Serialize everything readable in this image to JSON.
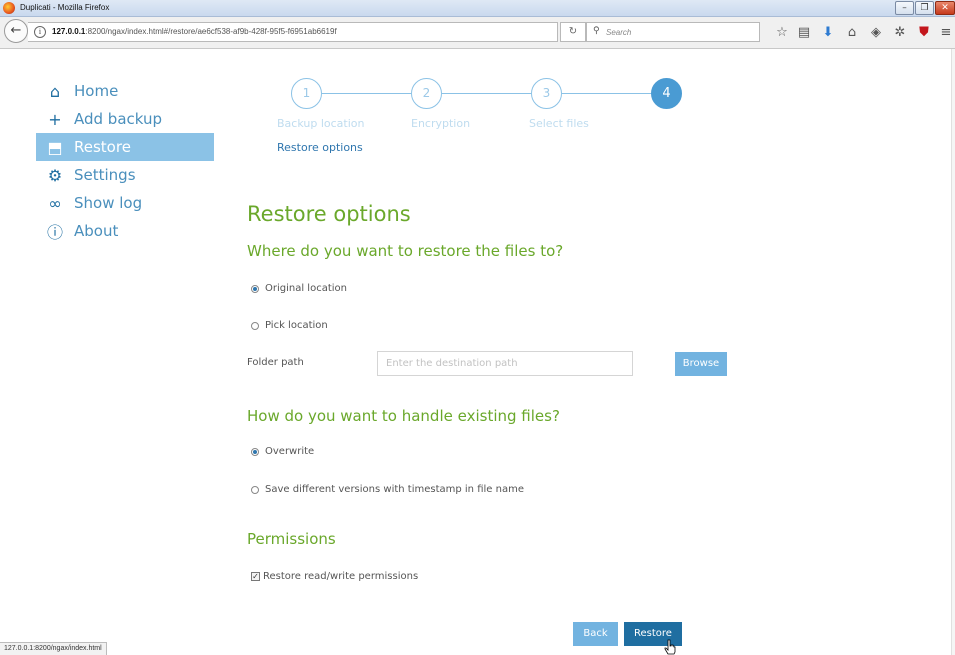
{
  "window": {
    "title": "Duplicati - Mozilla Firefox"
  },
  "browser": {
    "url_host": "127.0.0.1",
    "url_rest": ":8200/ngax/index.html#/restore/ae6cf538-af9b-428f-95f5-f6951ab6619f",
    "search_placeholder": "Search",
    "status_url": "127.0.0.1:8200/ngax/index.html"
  },
  "sidebar": {
    "items": [
      {
        "label": "Home",
        "icon": "home-icon",
        "glyph": "⌂",
        "active": false
      },
      {
        "label": "Add backup",
        "icon": "plus-icon",
        "glyph": "+",
        "active": false
      },
      {
        "label": "Restore",
        "icon": "restore-icon",
        "glyph": "⬒",
        "active": true
      },
      {
        "label": "Settings",
        "icon": "gear-icon",
        "glyph": "⚙",
        "active": false
      },
      {
        "label": "Show log",
        "icon": "log-icon",
        "glyph": "∞",
        "active": false
      },
      {
        "label": "About",
        "icon": "info-icon",
        "glyph": "ⓘ",
        "active": false
      }
    ]
  },
  "steps": [
    {
      "number": "1",
      "label": "Backup location",
      "active": false
    },
    {
      "number": "2",
      "label": "Encryption",
      "active": false
    },
    {
      "number": "3",
      "label": "Select files",
      "active": false
    },
    {
      "number": "4",
      "label": "Restore options",
      "active": true
    }
  ],
  "page": {
    "title": "Restore options",
    "destination": {
      "heading": "Where do you want to restore the files to?",
      "options": [
        {
          "label": "Original location",
          "selected": true
        },
        {
          "label": "Pick location",
          "selected": false
        }
      ],
      "folder_label": "Folder path",
      "folder_value": "",
      "folder_placeholder": "Enter the destination path",
      "browse_label": "Browse"
    },
    "existing": {
      "heading": "How do you want to handle existing files?",
      "options": [
        {
          "label": "Overwrite",
          "selected": true
        },
        {
          "label": "Save different versions with timestamp in file name",
          "selected": false
        }
      ]
    },
    "permissions": {
      "heading": "Permissions",
      "checkbox_label": "Restore read/write permissions",
      "checked": true
    },
    "back_label": "Back",
    "restore_label": "Restore"
  },
  "colors": {
    "accent_blue": "#1f6ea1",
    "light_blue": "#72b3e0",
    "heading_green": "#6aa82b"
  }
}
